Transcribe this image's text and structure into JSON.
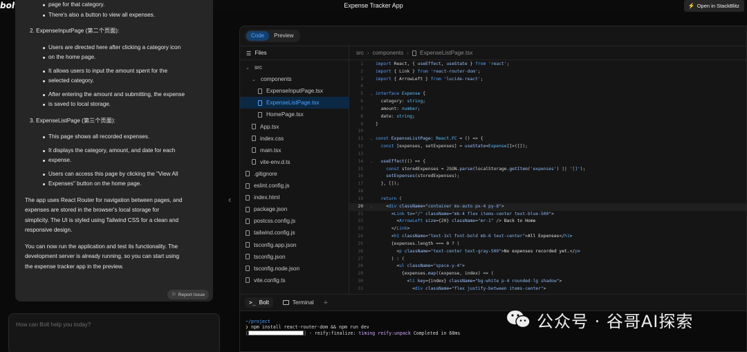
{
  "header": {
    "logo": "bolt",
    "title": "Expense Tracker App",
    "open_button": "Open in StackBlitz"
  },
  "chat": {
    "lines": [
      {
        "kind": "li",
        "text": "page for that category."
      },
      {
        "kind": "li",
        "text": "There's also a button to view all expenses."
      },
      {
        "kind": "gap-m"
      },
      {
        "kind": "h",
        "text": "2. ExpenseInputPage (第二个页面):"
      },
      {
        "kind": "gap-m"
      },
      {
        "kind": "li",
        "text": "Users are directed here after clicking a category icon"
      },
      {
        "kind": "li",
        "text": "on the home page."
      },
      {
        "kind": "gap-s"
      },
      {
        "kind": "li",
        "text": "It allows users to input the amount spent for the"
      },
      {
        "kind": "li",
        "text": "selected category."
      },
      {
        "kind": "gap-s"
      },
      {
        "kind": "li",
        "text": "After entering the amount and submitting, the expense"
      },
      {
        "kind": "li",
        "text": "is saved to local storage."
      },
      {
        "kind": "gap-m"
      },
      {
        "kind": "h",
        "text": "3. ExpenseListPage (第三个页面):"
      },
      {
        "kind": "gap-m"
      },
      {
        "kind": "li",
        "text": "This page shows all recorded expenses."
      },
      {
        "kind": "gap-s"
      },
      {
        "kind": "li",
        "text": "It displays the category, amount, and date for each"
      },
      {
        "kind": "li",
        "text": "expense."
      },
      {
        "kind": "gap-s"
      },
      {
        "kind": "li",
        "text": "Users can access this page by clicking the \"View All"
      },
      {
        "kind": "li",
        "text": "Expenses\" button on the home page."
      },
      {
        "kind": "gap-m"
      },
      {
        "kind": "p",
        "text": "The app uses React Router for navigation between pages, and"
      },
      {
        "kind": "p",
        "text": "expenses are stored in the browser's local storage for"
      },
      {
        "kind": "p",
        "text": "simplicity. The UI is styled using Tailwind CSS for a clean and"
      },
      {
        "kind": "p",
        "text": "responsive design."
      },
      {
        "kind": "gap-m"
      },
      {
        "kind": "p",
        "text": "You can now run the application and test its functionality. The"
      },
      {
        "kind": "p",
        "text": "development server is already running, so you can start using"
      },
      {
        "kind": "p",
        "text": "the expense tracker app in the preview."
      }
    ],
    "report_button": "Report Issue",
    "input_placeholder": "How can Bolt help you today?"
  },
  "workbench": {
    "view_tabs": [
      "Code",
      "Preview"
    ],
    "active_view": "Code",
    "files_title": "Files",
    "tree": [
      {
        "label": "src",
        "type": "folder",
        "depth": 0
      },
      {
        "label": "components",
        "type": "folder",
        "depth": 1
      },
      {
        "label": "ExpenseInputPage.tsx",
        "type": "file",
        "depth": 2
      },
      {
        "label": "ExpenseListPage.tsx",
        "type": "file",
        "depth": 2,
        "active": true
      },
      {
        "label": "HomePage.tsx",
        "type": "file",
        "depth": 2
      },
      {
        "label": "App.tsx",
        "type": "file",
        "depth": 1
      },
      {
        "label": "index.css",
        "type": "file",
        "depth": 1
      },
      {
        "label": "main.tsx",
        "type": "file",
        "depth": 1
      },
      {
        "label": "vite-env.d.ts",
        "type": "file",
        "depth": 1
      },
      {
        "label": ".gitignore",
        "type": "file",
        "depth": 0
      },
      {
        "label": "eslint.config.js",
        "type": "file",
        "depth": 0
      },
      {
        "label": "index.html",
        "type": "file",
        "depth": 0
      },
      {
        "label": "package.json",
        "type": "file",
        "depth": 0
      },
      {
        "label": "postcss.config.js",
        "type": "file",
        "depth": 0
      },
      {
        "label": "tailwind.config.js",
        "type": "file",
        "depth": 0
      },
      {
        "label": "tsconfig.app.json",
        "type": "file",
        "depth": 0
      },
      {
        "label": "tsconfig.json",
        "type": "file",
        "depth": 0
      },
      {
        "label": "tsconfig.node.json",
        "type": "file",
        "depth": 0
      },
      {
        "label": "vite.config.ts",
        "type": "file",
        "depth": 0
      }
    ],
    "breadcrumb": [
      "src",
      "components",
      "ExpenseListPage.tsx"
    ],
    "current_line": 20,
    "code": [
      {
        "n": 1,
        "t": [
          [
            "kw",
            "import"
          ],
          [
            "var",
            " React, { "
          ],
          [
            "fn",
            "useEffect"
          ],
          [
            "var",
            ", "
          ],
          [
            "fn",
            "useState"
          ],
          [
            "var",
            " } "
          ],
          [
            "kw",
            "from"
          ],
          [
            "str",
            " 'react'"
          ],
          [
            "var",
            ";"
          ]
        ]
      },
      {
        "n": 2,
        "t": [
          [
            "kw",
            "import"
          ],
          [
            "var",
            " { Link } "
          ],
          [
            "kw",
            "from"
          ],
          [
            "str",
            " 'react-router-dom'"
          ],
          [
            "var",
            ";"
          ]
        ]
      },
      {
        "n": 3,
        "t": [
          [
            "kw",
            "import"
          ],
          [
            "var",
            " { ArrowLeft } "
          ],
          [
            "kw",
            "from"
          ],
          [
            "str",
            " 'lucide-react'"
          ],
          [
            "var",
            ";"
          ]
        ]
      },
      {
        "n": 4,
        "t": []
      },
      {
        "n": 5,
        "fold": true,
        "t": [
          [
            "kw",
            "interface"
          ],
          [
            "typ",
            " Expense"
          ],
          [
            "var",
            " {"
          ]
        ]
      },
      {
        "n": 6,
        "t": [
          [
            "var",
            "  category: "
          ],
          [
            "typ",
            "string"
          ],
          [
            "var",
            ";"
          ]
        ]
      },
      {
        "n": 7,
        "t": [
          [
            "var",
            "  amount: "
          ],
          [
            "typ",
            "number"
          ],
          [
            "var",
            ";"
          ]
        ]
      },
      {
        "n": 8,
        "t": [
          [
            "var",
            "  date: "
          ],
          [
            "typ",
            "string"
          ],
          [
            "var",
            ";"
          ]
        ]
      },
      {
        "n": 9,
        "t": [
          [
            "var",
            "}"
          ]
        ]
      },
      {
        "n": 10,
        "t": []
      },
      {
        "n": 11,
        "fold": true,
        "t": [
          [
            "kw",
            "const"
          ],
          [
            "fn",
            " ExpenseListPage"
          ],
          [
            "var",
            ": "
          ],
          [
            "typ",
            "React.FC"
          ],
          [
            "var",
            " = () => {"
          ]
        ]
      },
      {
        "n": 12,
        "t": [
          [
            "kw",
            "  const"
          ],
          [
            "var",
            " [expenses, setExpenses] = "
          ],
          [
            "fn",
            "useState"
          ],
          [
            "var",
            "<"
          ],
          [
            "typ",
            "Expense"
          ],
          [
            "var",
            "[]>([]);"
          ]
        ]
      },
      {
        "n": 13,
        "t": []
      },
      {
        "n": 14,
        "fold": true,
        "t": [
          [
            "fn",
            "  useEffect"
          ],
          [
            "var",
            "(() => {"
          ]
        ]
      },
      {
        "n": 15,
        "t": [
          [
            "kw",
            "    const"
          ],
          [
            "var",
            " storedExpenses = JSON."
          ],
          [
            "fn",
            "parse"
          ],
          [
            "var",
            "(localStorage."
          ],
          [
            "fn",
            "getItem"
          ],
          [
            "var",
            "("
          ],
          [
            "str",
            "'expenses'"
          ],
          [
            "var",
            ") || "
          ],
          [
            "str",
            "'[]'"
          ],
          [
            "var",
            ");"
          ]
        ]
      },
      {
        "n": 16,
        "t": [
          [
            "fn",
            "    setExpenses"
          ],
          [
            "var",
            "(storedExpenses);"
          ]
        ]
      },
      {
        "n": 17,
        "t": [
          [
            "var",
            "  }, []);"
          ]
        ]
      },
      {
        "n": 18,
        "t": []
      },
      {
        "n": 19,
        "t": [
          [
            "kw",
            "  return"
          ],
          [
            "var",
            " ("
          ]
        ]
      },
      {
        "n": 20,
        "fold": true,
        "t": [
          [
            "var",
            "    <"
          ],
          [
            "tag",
            "div"
          ],
          [
            "var",
            " "
          ],
          [
            "fn",
            "className"
          ],
          [
            "var",
            "="
          ],
          [
            "str",
            "\"container mx-auto px-4 py-8\""
          ],
          [
            "var",
            ">"
          ]
        ]
      },
      {
        "n": 21,
        "t": [
          [
            "var",
            "      <"
          ],
          [
            "tag",
            "Link"
          ],
          [
            "var",
            " "
          ],
          [
            "fn",
            "to"
          ],
          [
            "var",
            "="
          ],
          [
            "str",
            "\"/\""
          ],
          [
            "var",
            " "
          ],
          [
            "fn",
            "className"
          ],
          [
            "var",
            "="
          ],
          [
            "str",
            "\"mb-4 flex items-center text-blue-500\""
          ],
          [
            "var",
            ">"
          ]
        ]
      },
      {
        "n": 22,
        "t": [
          [
            "var",
            "        <"
          ],
          [
            "tag",
            "ArrowLeft"
          ],
          [
            "var",
            " "
          ],
          [
            "fn",
            "size"
          ],
          [
            "var",
            "={20} "
          ],
          [
            "fn",
            "className"
          ],
          [
            "var",
            "="
          ],
          [
            "str",
            "\"mr-1\""
          ],
          [
            "var",
            " /> "
          ],
          [
            "txt",
            "Back to Home"
          ]
        ]
      },
      {
        "n": 23,
        "t": [
          [
            "var",
            "      </"
          ],
          [
            "tag",
            "Link"
          ],
          [
            "var",
            ">"
          ]
        ]
      },
      {
        "n": 24,
        "t": [
          [
            "var",
            "      <"
          ],
          [
            "tag",
            "h1"
          ],
          [
            "var",
            " "
          ],
          [
            "fn",
            "className"
          ],
          [
            "var",
            "="
          ],
          [
            "str",
            "\"text-3xl font-bold mb-6 text-center\""
          ],
          [
            "var",
            ">"
          ],
          [
            "txt",
            "All Expenses"
          ],
          [
            "var",
            "</"
          ],
          [
            "tag",
            "h1"
          ],
          [
            "var",
            ">"
          ]
        ]
      },
      {
        "n": 25,
        "t": [
          [
            "var",
            "      {expenses.length === 0 ? ("
          ]
        ]
      },
      {
        "n": 26,
        "t": [
          [
            "var",
            "        <"
          ],
          [
            "tag",
            "p"
          ],
          [
            "var",
            " "
          ],
          [
            "fn",
            "className"
          ],
          [
            "var",
            "="
          ],
          [
            "str",
            "\"text-center text-gray-500\""
          ],
          [
            "var",
            ">"
          ],
          [
            "txt",
            "No expenses recorded yet."
          ],
          [
            "var",
            "</"
          ],
          [
            "tag",
            "p"
          ],
          [
            "var",
            ">"
          ]
        ]
      },
      {
        "n": 27,
        "t": [
          [
            "var",
            "      ) : ("
          ]
        ]
      },
      {
        "n": 28,
        "t": [
          [
            "var",
            "        <"
          ],
          [
            "tag",
            "ul"
          ],
          [
            "var",
            " "
          ],
          [
            "fn",
            "className"
          ],
          [
            "var",
            "="
          ],
          [
            "str",
            "\"space-y-4\""
          ],
          [
            "var",
            ">"
          ]
        ]
      },
      {
        "n": 29,
        "t": [
          [
            "var",
            "          {expenses."
          ],
          [
            "fn",
            "map"
          ],
          [
            "var",
            "((expense, index) => ("
          ]
        ]
      },
      {
        "n": 30,
        "t": [
          [
            "var",
            "            <"
          ],
          [
            "tag",
            "li"
          ],
          [
            "var",
            " "
          ],
          [
            "fn",
            "key"
          ],
          [
            "var",
            "={index} "
          ],
          [
            "fn",
            "className"
          ],
          [
            "var",
            "="
          ],
          [
            "str",
            "\"bg-white p-4 rounded-lg shadow\""
          ],
          [
            "var",
            ">"
          ]
        ]
      },
      {
        "n": 31,
        "t": [
          [
            "var",
            "              <"
          ],
          [
            "tag",
            "div"
          ],
          [
            "var",
            " "
          ],
          [
            "fn",
            "className"
          ],
          [
            "var",
            "="
          ],
          [
            "str",
            "\"flex justify-between items-center\""
          ],
          [
            "var",
            ">"
          ]
        ]
      }
    ],
    "terminal_tabs": [
      "Bolt",
      "Terminal"
    ],
    "terminal": {
      "path": "~/project",
      "command": "npm install react-router-dom && npm run dev",
      "progress": 1.0,
      "status_prefix": " - reify:finalize: ",
      "status_timing": "timing",
      "status_task": "reify:unpack",
      "status_rest": " Completed in 68ms"
    }
  },
  "watermark": "公众号 · 谷哥AI探索"
}
